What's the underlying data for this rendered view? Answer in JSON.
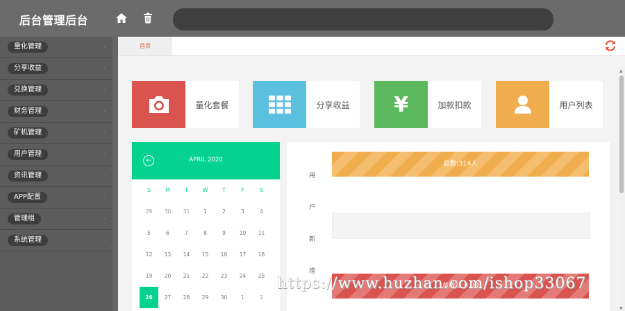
{
  "header": {
    "brand": "后台管理后台",
    "search_placeholder": ""
  },
  "sidebar": {
    "items": [
      {
        "label": "量化管理"
      },
      {
        "label": "分享收益"
      },
      {
        "label": "兑换管理"
      },
      {
        "label": "财务管理"
      },
      {
        "label": "矿机管理"
      },
      {
        "label": "用户管理"
      },
      {
        "label": "资讯管理"
      },
      {
        "label": "APP配置"
      },
      {
        "label": "管理组"
      },
      {
        "label": "系统管理"
      }
    ]
  },
  "tabs": {
    "home": "首页"
  },
  "tiles": [
    {
      "label": "量化套餐",
      "color": "#d9534f",
      "icon": "camera-icon"
    },
    {
      "label": "分享收益",
      "color": "#5bc0de",
      "icon": "grid-icon"
    },
    {
      "label": "加款扣款",
      "color": "#5cb85c",
      "icon": "yen-icon"
    },
    {
      "label": "用户列表",
      "color": "#f0ad4e",
      "icon": "user-icon"
    }
  ],
  "calendar": {
    "title": "APRIL 2020",
    "weekdays": [
      "S",
      "M",
      "T",
      "W",
      "T",
      "F",
      "S"
    ],
    "weeks": [
      [
        "29",
        "30",
        "31",
        "1",
        "2",
        "3",
        "4"
      ],
      [
        "5",
        "6",
        "7",
        "8",
        "9",
        "10",
        "11"
      ],
      [
        "12",
        "13",
        "14",
        "15",
        "16",
        "17",
        "18"
      ],
      [
        "19",
        "20",
        "21",
        "22",
        "23",
        "24",
        "25"
      ],
      [
        "26",
        "27",
        "28",
        "29",
        "30",
        "1",
        "2"
      ]
    ],
    "today": "26"
  },
  "panel": {
    "side_chars": [
      "用",
      "户",
      "新",
      "增"
    ],
    "bars": [
      {
        "text": "总数:314人"
      },
      {
        "text": ""
      },
      {
        "text": "总收益:0.00"
      }
    ]
  },
  "watermark": "https://www.huzhan.com/ishop33067"
}
